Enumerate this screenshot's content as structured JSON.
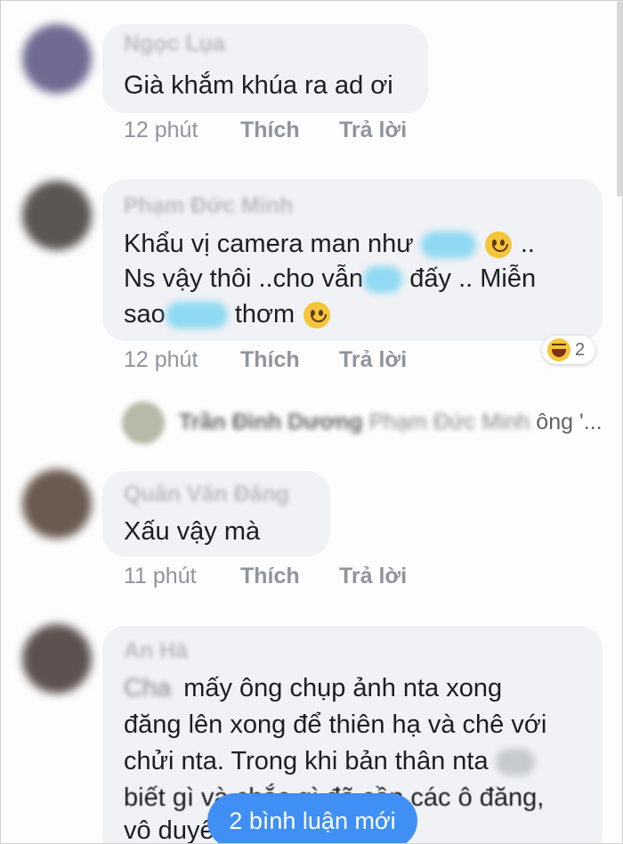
{
  "comments": [
    {
      "author": "Ngọc Lụa",
      "lines": [
        "Già khắm khúa ra ad ơi"
      ],
      "time": "12 phút",
      "like_label": "Thích",
      "reply_label": "Trả lời"
    },
    {
      "author": "Phạm Đức Minh",
      "line1_a": "Khẩu vị camera man như",
      "line1_b": "..",
      "line2_a": "Ns vậy thôi ..cho vẫn",
      "line2_b": "đấy .. Miễn",
      "line3_a": "sao",
      "line3_b": "thơm",
      "time": "12 phút",
      "like_label": "Thích",
      "reply_label": "Trả lời",
      "reaction_icon": "haha-icon",
      "reaction_count": "2"
    },
    {
      "author": "Quân Văn Đăng",
      "lines": [
        "Xấu vậy mà"
      ],
      "time": "11 phút",
      "like_label": "Thích",
      "reply_label": "Trả lời"
    },
    {
      "author": "An Hà",
      "line1_blur": "Cha",
      "line1": "mấy ông chụp ảnh nta xong",
      "line2": "đăng lên xong để thiên hạ và chê với",
      "line3": "chửi nta. Trong khi bản thân nta",
      "line4": "biết gì và chắc gì đã cần các ô đăng,",
      "line5": "vô duyê"
    }
  ],
  "reply_preview": {
    "author": "Trần Đình Dương",
    "mention": "Phạm Đức Minh",
    "text": "ông",
    "ellipsis": "'..."
  },
  "new_comments_button": "2 bình luận mới",
  "colors": {
    "bubble": "#f0f2f5",
    "meta_text": "#90949c",
    "button": "#3f8ff5",
    "redaction": "#8fd9f2"
  }
}
